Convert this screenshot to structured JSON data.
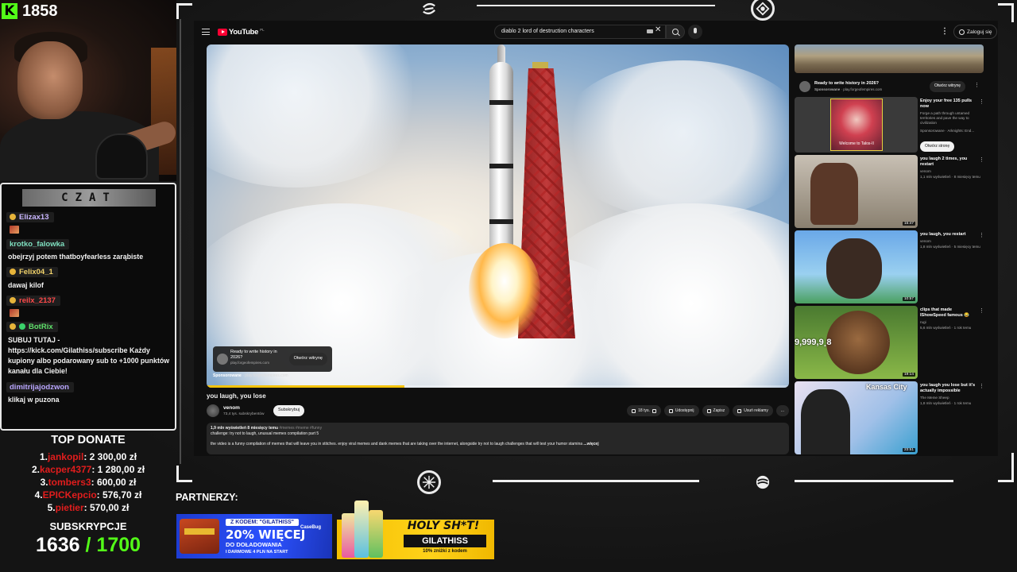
{
  "stream": {
    "viewer_count": "1858",
    "chat_title": "CZAT",
    "chat": [
      {
        "user": "Elizax13",
        "color": "#c9b6ff",
        "text": ""
      },
      {
        "user": "krotko_falowka",
        "color": "#7fe0c0",
        "text": "obejrzyj potem thatboyfearless zarąbiste"
      },
      {
        "user": "Felix04_1",
        "color": "#f2d36a",
        "text": "dawaj kilof"
      },
      {
        "user": "reilx_2137",
        "color": "#ff4a4a",
        "text": ""
      },
      {
        "user": "BotRix",
        "color": "#5ee06a",
        "text": "SUBUJ TUTAJ - https://kick.com/Gilathiss/subscribe Każdy kupiony albo podarowany sub to +1000 punktów kanału dla Ciebie!"
      },
      {
        "user": "dimitrijajodzwon",
        "color": "#b9a6ff",
        "text": "klikaj w puzona"
      }
    ],
    "top_donate_title": "TOP DONATE",
    "top_donate": [
      {
        "rank": "1.",
        "name": "jankopil",
        "amount": ": 2 300,00 zł"
      },
      {
        "rank": "2.",
        "name": "kacper4377",
        "amount": ": 1 280,00 zł"
      },
      {
        "rank": "3.",
        "name": "tombers3",
        "amount": ": 600,00 zł"
      },
      {
        "rank": "4.",
        "name": "EPICKepcio",
        "amount": ": 576,70 zł"
      },
      {
        "rank": "5.",
        "name": "pietier",
        "amount": ": 570,00 zł"
      }
    ],
    "subs_title": "SUBSKRYPCJE",
    "subs_current": "1636",
    "subs_goal": "/ 1700",
    "partners_label": "PARTNERZY:",
    "banner_casebug": {
      "code": "Z KODEM: \"GILATHISS\"",
      "brand": "CaseBug",
      "headline": "20% WIĘCEJ",
      "line2": "DO DOŁADOWANIA",
      "line3": "I DARMOWE 4 PLN NA START"
    },
    "banner_drink": {
      "title": "HOLY SH*T!",
      "code": "GILATHISS",
      "small": "10% zniżki z kodem"
    }
  },
  "youtube": {
    "logo_text": "YouTube",
    "country": "PL",
    "search_value": "diablo 2 lord of destruction characters",
    "signin_label": "Zaloguj się",
    "video_title": "you laugh, you lose",
    "channel_name": "venom",
    "channel_subs": "73,4 tys. subskrybentów",
    "subscribe_label": "Subskrybuj",
    "progress_fraction": 0.34,
    "actions": [
      "18 tys.",
      "",
      "Udostępnij",
      "Zapisz",
      "Usuń reklamy",
      "..."
    ],
    "desc_meta": "1,9 mln wyświetleń  8 miesięcy temu",
    "desc_tags": "#memes #meme #funny",
    "desc_line1": "challenge: try not to laugh, unusual memes compilation part 5",
    "desc_line2": "the video is a funny compilation of memes that will leave you in stitches. enjoy viral memes and dank memes that are taking over the internet, alongside try not to laugh challenges that will test your humor stamina",
    "desc_more": "...więcej",
    "overlay_ad": {
      "title": "Ready to write history in 2026?",
      "url": "play.forgeofempires.com",
      "button": "Otwórz witrynę",
      "sponsored": "Sponsorowane",
      "sponsored_url": "play.forgeofempires.com"
    },
    "side_ad": {
      "title": "Ready to write history in 2026?",
      "sponsored": "Sponsorowane",
      "url": "play.forgeofempires.com",
      "button": "Otwórz witrynę"
    },
    "recs": [
      {
        "title": "Enjoy your free 135 pulls now",
        "channel": "Forge a path through untamed territories and pave the way to civilization",
        "meta": "Sponsorowane · Arknights: End...",
        "button": "Otwórz stronę",
        "thumb_text": "Welcome to Talos-II",
        "duration": ""
      },
      {
        "title": "you laugh 2 times, you restart",
        "channel": "venom",
        "meta": "1,1 mln wyświetleń · 8 miesięcy temu",
        "duration": "15:47"
      },
      {
        "title": "you laugh, you restart",
        "channel": "venom",
        "meta": "1,8 mln wyświetleń · 5 miesięcy temu",
        "duration": "10:57"
      },
      {
        "title": "clips that made IShowSpeed famous 😂",
        "channel": "rugi",
        "meta": "5,6 mln wyświetleń · 1 rok temu",
        "duration": "19:14",
        "thumb_text": "9,999,9¸8"
      },
      {
        "title": "you laugh you lose but it's actually impossible",
        "channel": "The Meme Sheep",
        "meta": "1,8 mln wyświetleń · 1 rok temu",
        "duration": "23:51",
        "thumb_text": "Kansas City"
      }
    ]
  }
}
